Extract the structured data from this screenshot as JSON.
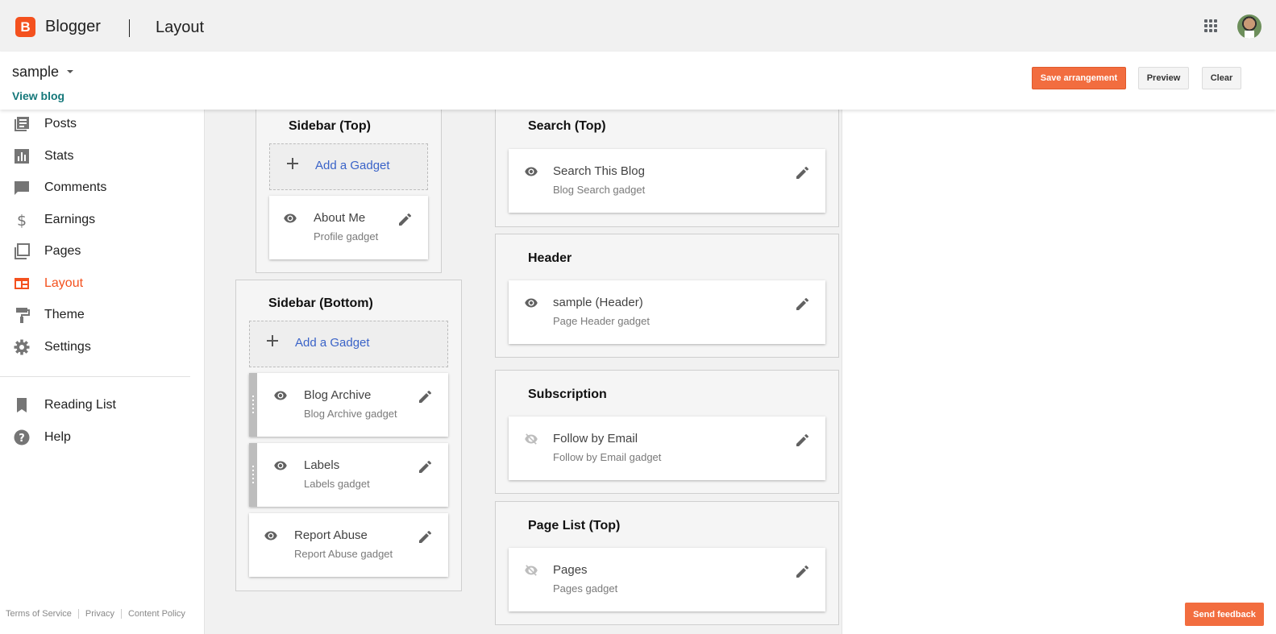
{
  "app": {
    "brand": "Blogger",
    "section": "Layout"
  },
  "blog": {
    "name": "sample",
    "view_label": "View blog"
  },
  "actions": {
    "save": "Save arrangement",
    "preview": "Preview",
    "clear": "Clear"
  },
  "nav": {
    "items": [
      {
        "label": "Posts",
        "icon": "posts-icon"
      },
      {
        "label": "Stats",
        "icon": "stats-icon"
      },
      {
        "label": "Comments",
        "icon": "comments-icon"
      },
      {
        "label": "Earnings",
        "icon": "dollar-icon"
      },
      {
        "label": "Pages",
        "icon": "pages-icon"
      },
      {
        "label": "Layout",
        "icon": "layout-icon",
        "active": true
      },
      {
        "label": "Theme",
        "icon": "paint-roller-icon"
      },
      {
        "label": "Settings",
        "icon": "gear-icon"
      }
    ],
    "secondary": [
      {
        "label": "Reading List",
        "icon": "bookmark-icon"
      },
      {
        "label": "Help",
        "icon": "help-icon"
      }
    ]
  },
  "footer": {
    "terms": "Terms of Service",
    "privacy": "Privacy",
    "content_policy": "Content Policy"
  },
  "add_gadget_label": "Add a Gadget",
  "regions": {
    "sidebar_top": {
      "title": "Sidebar (Top)",
      "gadgets": [
        {
          "name": "About Me",
          "type": "Profile gadget",
          "visible": true
        }
      ]
    },
    "sidebar_bottom": {
      "title": "Sidebar (Bottom)",
      "gadgets": [
        {
          "name": "Blog Archive",
          "type": "Blog Archive gadget",
          "visible": true
        },
        {
          "name": "Labels",
          "type": "Labels gadget",
          "visible": true
        },
        {
          "name": "Report Abuse",
          "type": "Report Abuse gadget",
          "visible": true
        }
      ]
    },
    "search_top": {
      "title": "Search (Top)",
      "gadgets": [
        {
          "name": "Search This Blog",
          "type": "Blog Search gadget",
          "visible": true
        }
      ]
    },
    "header": {
      "title": "Header",
      "gadgets": [
        {
          "name": "sample (Header)",
          "type": "Page Header gadget",
          "visible": true
        }
      ]
    },
    "subscription": {
      "title": "Subscription",
      "gadgets": [
        {
          "name": "Follow by Email",
          "type": "Follow by Email gadget",
          "visible": false
        }
      ]
    },
    "page_list_top": {
      "title": "Page List (Top)",
      "gadgets": [
        {
          "name": "Pages",
          "type": "Pages gadget",
          "visible": false
        }
      ]
    }
  },
  "feedback_label": "Send feedback",
  "colors": {
    "accent": "#f4511e",
    "save_button": "#f26d3f",
    "link": "#3a63c8",
    "view_blog": "#15787a"
  }
}
